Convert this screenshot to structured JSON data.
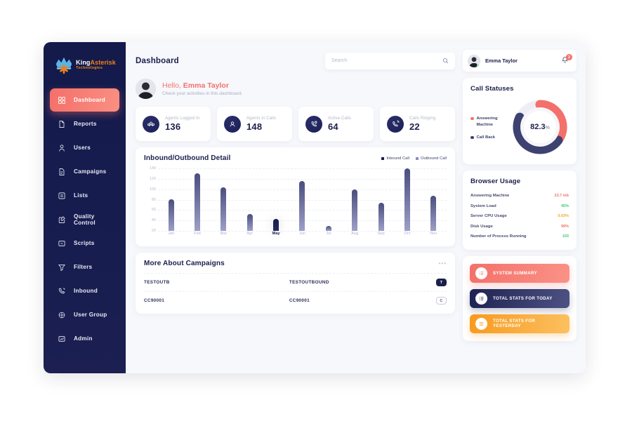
{
  "brand": {
    "name_primary": "King",
    "name_secondary": "Asterisk",
    "tagline": "Technologies",
    "crown_icon": "crown-icon",
    "asterisk_icon": "asterisk-icon"
  },
  "sidebar": {
    "items": [
      {
        "label": "Dashboard",
        "icon": "grid-icon",
        "active": true
      },
      {
        "label": "Reports",
        "icon": "document-icon",
        "active": false
      },
      {
        "label": "Users",
        "icon": "user-icon",
        "active": false
      },
      {
        "label": "Campaigns",
        "icon": "file-icon",
        "active": false
      },
      {
        "label": "Lists",
        "icon": "list-icon",
        "active": false
      },
      {
        "label": "Quality Control",
        "icon": "edit-square-icon",
        "active": false
      },
      {
        "label": "Scripts",
        "icon": "terminal-icon",
        "active": false
      },
      {
        "label": "Filters",
        "icon": "funnel-icon",
        "active": false
      },
      {
        "label": "Inbound",
        "icon": "phone-icon",
        "active": false
      },
      {
        "label": "User Group",
        "icon": "group-icon",
        "active": false
      },
      {
        "label": "Admin",
        "icon": "chart-icon",
        "active": false
      }
    ]
  },
  "header": {
    "title": "Dashboard",
    "search": {
      "placeholder": "Search",
      "value": "",
      "icon": "search-icon"
    },
    "user": {
      "name": "Emma Taylor",
      "avatar": "avatar",
      "status": "online"
    },
    "notifications": {
      "icon": "bell-icon",
      "count": "2"
    }
  },
  "greeting": {
    "prefix": "Hello, ",
    "name": "Emma Taylor",
    "subtitle": "Check your activities in this dashboard."
  },
  "stats": [
    {
      "label": "Agents Logged In",
      "value": "136",
      "icon": "agents-icon"
    },
    {
      "label": "Agents in Calls",
      "value": "148",
      "icon": "agent-call-icon"
    },
    {
      "label": "Active Calls",
      "value": "64",
      "icon": "active-call-icon"
    },
    {
      "label": "Calls Ringing",
      "value": "22",
      "icon": "ringing-phone-icon"
    }
  ],
  "chart_data": {
    "type": "bar",
    "title": "Inbound/Outbound Detail",
    "categories": [
      "Jan",
      "Feb",
      "Mar",
      "Apr",
      "May",
      "Jun",
      "Jul",
      "Aug",
      "Sep",
      "Oct",
      "Nov"
    ],
    "values": [
      81,
      130,
      103,
      53,
      43,
      116,
      30,
      100,
      74,
      140,
      87
    ],
    "highlight_index": 4,
    "highlight_series": "Inbound Call",
    "base_series": "Outbound Call",
    "legend": [
      {
        "label": "Inbound Call",
        "color": "#1b2050"
      },
      {
        "label": "Outbound Call",
        "color": "#8c8fbd"
      }
    ],
    "ylim": [
      20,
      140
    ],
    "yticks": [
      140,
      120,
      100,
      80,
      60,
      40,
      20
    ],
    "xlabel": "",
    "ylabel": "",
    "grid": true,
    "legend_position": "top-right"
  },
  "campaigns": {
    "title": "More About Campaigns",
    "menu_icon": "more-horizontal-icon",
    "rows": [
      {
        "col1": "TESTOUTB",
        "col2": "TESTOUTBOUND",
        "tag": "T",
        "tag_style": "filled"
      },
      {
        "col1": "CC90001",
        "col2": "CC90001",
        "tag": "C",
        "tag_style": "outline"
      }
    ]
  },
  "call_statuses": {
    "title": "Call Statuses",
    "center_value": "82.3",
    "center_unit": "%",
    "legend": [
      {
        "label": "Answering Machine",
        "color": "#f4706a",
        "percent": 35
      },
      {
        "label": "Call Back",
        "color": "#3d4270",
        "percent": 47
      }
    ],
    "track_color": "#eeeff5"
  },
  "browser_usage": {
    "title": "Browser Usage",
    "rows": [
      {
        "label": "Answering Machine",
        "value": "23.7 mb",
        "color": "#f4706a"
      },
      {
        "label": "System Load",
        "value": "45%",
        "color": "#3ec97a"
      },
      {
        "label": "Server CPU Usage",
        "value": "0.03%",
        "color": "#f5a623"
      },
      {
        "label": "Disk Usage",
        "value": "99%",
        "color": "#f4706a"
      },
      {
        "label": "Number of Process Running",
        "value": "103",
        "color": "#3ec97a"
      }
    ]
  },
  "actions": [
    {
      "label": "SYSTEM SUMMARY",
      "style": "act-red",
      "icon": "list-lines-icon"
    },
    {
      "label": "TOTAL STATS FOR TODAY",
      "style": "act-navy",
      "icon": "list-lines-icon"
    },
    {
      "label": "TOTAL STATS FOR YESTERDAY",
      "style": "act-orange",
      "icon": "list-lines-icon"
    }
  ]
}
